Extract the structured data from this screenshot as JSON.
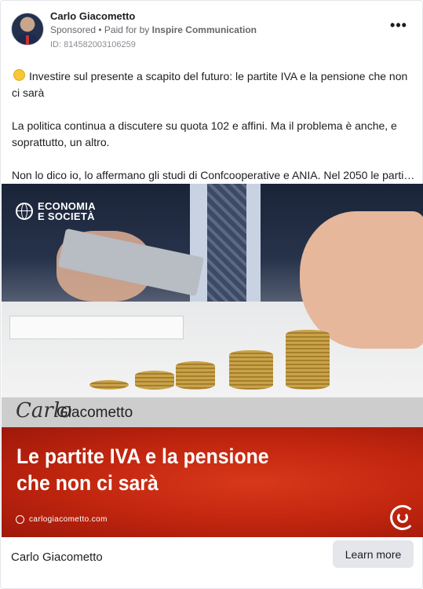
{
  "advertiser": {
    "name": "Carlo Giacometto",
    "sponsored_label": "Sponsored",
    "paid_for_prefix": " • Paid for by ",
    "paid_for_by": "Inspire Communication",
    "ad_id": "ID: 814582003106259"
  },
  "menu": {
    "more_icon": "more-horizontal-icon",
    "label": "•••"
  },
  "post": {
    "lines": [
      "Investire sul presente a scapito del futuro: le partite IVA e la pensione che non ci sarà",
      "La politica continua a discutere su quota 102 e affini. Ma il problema è anche, e soprattutto, un altro.",
      "Non lo dico io, lo affermano gli studi di Confcooperative e ANIA. Nel 2050 le parti…"
    ],
    "emoji": "yellow-circle"
  },
  "creative": {
    "overlay_logo_line1": "ECONOMIA",
    "overlay_logo_line2": "E SOCIETÀ",
    "signature": "Carlo",
    "signature_surname": "Giacometto",
    "headline_line1": "Le partite IVA e la pensione",
    "headline_line2": "che non ci sarà",
    "website": "carlogiacometto.com",
    "colors": {
      "banner_red": "#c2260f",
      "banner_grey": "#cdcdcd"
    }
  },
  "footer": {
    "name": "Carlo Giacometto",
    "cta_label": "Learn more"
  }
}
